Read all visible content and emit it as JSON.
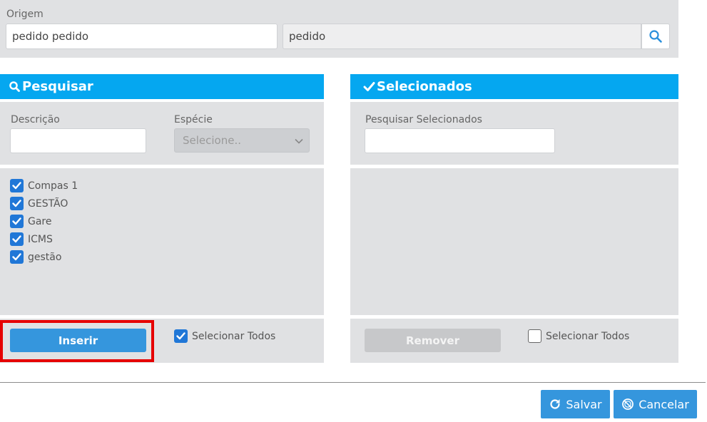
{
  "origem": {
    "label": "Origem",
    "input1_value": "pedido pedido",
    "input2_value": "pedido",
    "search_icon": "search-icon"
  },
  "pesquisar": {
    "title": "Pesquisar",
    "descricao_label": "Descrição",
    "descricao_value": "",
    "especie_label": "Espécie",
    "especie_selected": "Selecione..",
    "items": [
      {
        "label": "Compas 1",
        "checked": true
      },
      {
        "label": "GESTÃO",
        "checked": true
      },
      {
        "label": "Gare",
        "checked": true
      },
      {
        "label": "ICMS",
        "checked": true
      },
      {
        "label": "gestão",
        "checked": true
      }
    ],
    "insert_label": "Inserir",
    "select_all_label": "Selecionar Todos",
    "select_all_checked": true
  },
  "selecionados": {
    "title": "Selecionados",
    "search_label": "Pesquisar Selecionados",
    "search_value": "",
    "remove_label": "Remover",
    "select_all_label": "Selecionar Todos",
    "select_all_checked": false
  },
  "footer": {
    "save_label": "Salvar",
    "cancel_label": "Cancelar"
  },
  "colors": {
    "header_blue": "#05a7f0",
    "button_blue": "#3596dd",
    "checkbox_blue": "#2077d7",
    "highlight_red": "#e60000"
  }
}
